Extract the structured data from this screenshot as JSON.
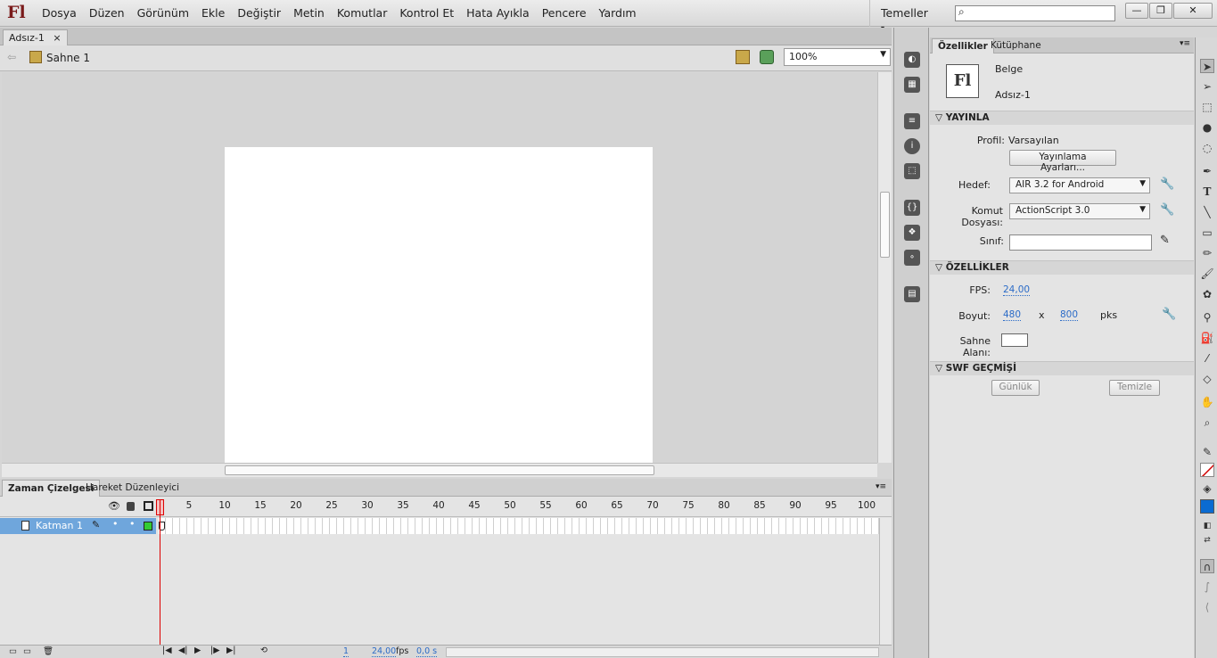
{
  "app": {
    "logo": "Fl",
    "menu": [
      "Dosya",
      "Düzen",
      "Görünüm",
      "Ekle",
      "Değiştir",
      "Metin",
      "Komutlar",
      "Kontrol Et",
      "Hata Ayıkla",
      "Pencere",
      "Yardım"
    ],
    "workspace": "Temeller"
  },
  "document": {
    "tab": "Adsız-1",
    "scene": "Sahne 1",
    "zoom": "100%"
  },
  "timeline": {
    "tabs": [
      "Zaman Çizelgesi",
      "Hareket Düzenleyici"
    ],
    "layer": "Katman 1",
    "ruler": [
      "1",
      "5",
      "10",
      "15",
      "20",
      "25",
      "30",
      "35",
      "40",
      "45",
      "50",
      "55",
      "60",
      "65",
      "70",
      "75",
      "80",
      "85",
      "90",
      "95",
      "100"
    ],
    "frame": "1",
    "fps": "24,00",
    "fps_unit": "fps",
    "time": "0,0 s"
  },
  "properties": {
    "tabs": [
      "Özellikler",
      "Kütüphane"
    ],
    "doc_icon": "Fl",
    "doc_type": "Belge",
    "doc_name": "Adsız-1",
    "publish": {
      "title": "YAYINLA",
      "profile_label": "Profil:",
      "profile_value": "Varsayılan",
      "settings_btn": "Yayınlama Ayarları...",
      "target_label": "Hedef:",
      "target_value": "AIR 3.2 for Android",
      "script_label": "Komut Dosyası:",
      "script_value": "ActionScript 3.0",
      "class_label": "Sınıf:"
    },
    "props": {
      "title": "ÖZELLİKLER",
      "fps_label": "FPS:",
      "fps_value": "24,00",
      "size_label": "Boyut:",
      "width": "480",
      "x": "x",
      "height": "800",
      "unit": "pks",
      "stage_label": "Sahne Alanı:",
      "stage_color": "#ffffff"
    },
    "swf": {
      "title": "SWF GEÇMİŞİ",
      "log_btn": "Günlük",
      "clear_btn": "Temizle"
    }
  },
  "colors": {
    "stroke": "#d00000",
    "fill": "#0a6bd1"
  }
}
